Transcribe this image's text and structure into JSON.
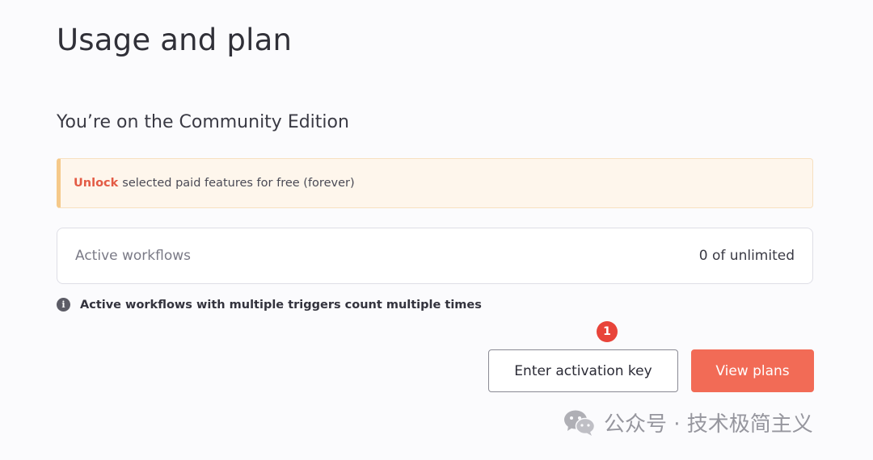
{
  "header": {
    "title": "Usage and plan"
  },
  "plan": {
    "edition_title": "You’re on the Community Edition"
  },
  "callout": {
    "link_text": "Unlock",
    "text": "selected paid features for free (forever)"
  },
  "usage": {
    "label": "Active workflows",
    "value": "0 of unlimited"
  },
  "note": {
    "icon": "info-icon",
    "text": "Active workflows with multiple triggers count multiple times"
  },
  "annotation": {
    "badge": "1"
  },
  "actions": {
    "activation_label": "Enter activation key",
    "view_plans_label": "View plans"
  },
  "watermark": {
    "text": "公众号 · 技术极简主义"
  },
  "colors": {
    "accent": "#f26b56",
    "unlock": "#e35b45",
    "callout_bg": "#fef6ec",
    "callout_border": "#f5c98a",
    "badge": "#e8443a"
  }
}
